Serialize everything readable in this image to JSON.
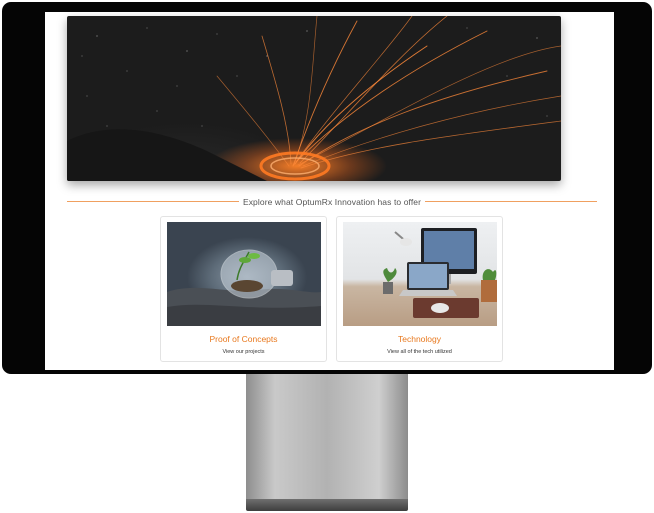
{
  "banner": {
    "icon": "sparks-hero-image"
  },
  "section": {
    "heading": "Explore what OptumRx Innovation has to offer"
  },
  "cards": [
    {
      "title": "Proof of Concepts",
      "subtitle": "View our projects",
      "image": "lightbulb-plant-image"
    },
    {
      "title": "Technology",
      "subtitle": "View all of the tech utilized",
      "image": "desk-workspace-image"
    }
  ],
  "colors": {
    "accent": "#e8791f",
    "divider": "#f0a060",
    "bezel": "#050505"
  }
}
